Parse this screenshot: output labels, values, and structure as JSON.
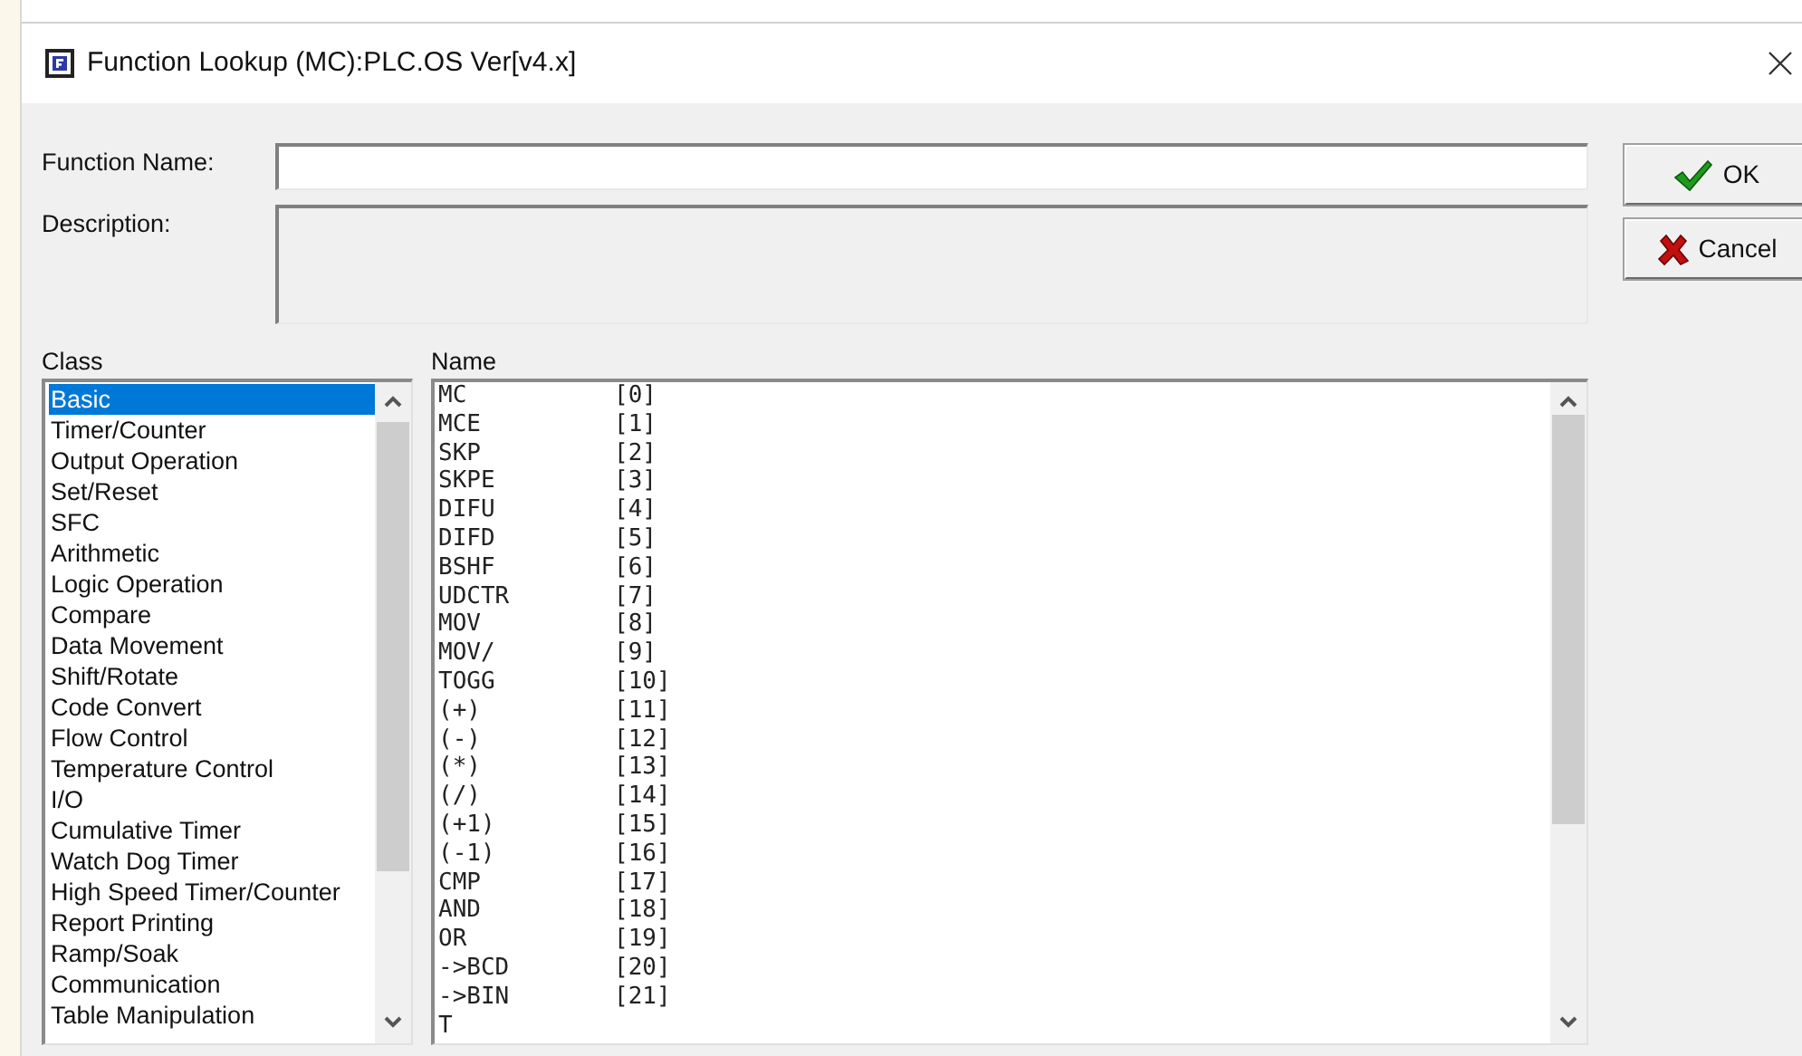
{
  "window": {
    "title": "Function Lookup (MC):PLC.OS Ver[v4.x]"
  },
  "fields": [
    {
      "label": "Function Name:"
    },
    {
      "label": "Description:"
    }
  ],
  "buttons": [
    {
      "kind": "ok",
      "label": "OK"
    },
    {
      "kind": "cancel",
      "label": "Cancel"
    }
  ],
  "class_list": {
    "heading": "Class",
    "items": [
      {
        "label": "Basic",
        "selected": true
      },
      {
        "label": "Timer/Counter",
        "selected": false
      },
      {
        "label": "Output Operation",
        "selected": false
      },
      {
        "label": "Set/Reset",
        "selected": false
      },
      {
        "label": "SFC",
        "selected": false
      },
      {
        "label": "Arithmetic",
        "selected": false
      },
      {
        "label": "Logic Operation",
        "selected": false
      },
      {
        "label": "Compare",
        "selected": false
      },
      {
        "label": "Data Movement",
        "selected": false
      },
      {
        "label": "Shift/Rotate",
        "selected": false
      },
      {
        "label": "Code Convert",
        "selected": false
      },
      {
        "label": "Flow Control",
        "selected": false
      },
      {
        "label": "Temperature Control",
        "selected": false
      },
      {
        "label": "I/O",
        "selected": false
      },
      {
        "label": "Cumulative Timer",
        "selected": false
      },
      {
        "label": "Watch Dog Timer",
        "selected": false
      },
      {
        "label": "High Speed Timer/Counter",
        "selected": false
      },
      {
        "label": "Report Printing",
        "selected": false
      },
      {
        "label": "Ramp/Soak",
        "selected": false
      },
      {
        "label": "Communication",
        "selected": false
      },
      {
        "label": "Table Manipulation",
        "selected": false
      }
    ]
  },
  "name_list": {
    "heading": "Name",
    "items": [
      {
        "name": "MC",
        "code": "[0]"
      },
      {
        "name": "MCE",
        "code": "[1]"
      },
      {
        "name": "SKP",
        "code": "[2]"
      },
      {
        "name": "SKPE",
        "code": "[3]"
      },
      {
        "name": "DIFU",
        "code": "[4]"
      },
      {
        "name": "DIFD",
        "code": "[5]"
      },
      {
        "name": "BSHF",
        "code": "[6]"
      },
      {
        "name": "UDCTR",
        "code": "[7]"
      },
      {
        "name": "MOV",
        "code": "[8]"
      },
      {
        "name": "MOV/",
        "code": "[9]"
      },
      {
        "name": "TOGG",
        "code": "[10]"
      },
      {
        "name": "(+)",
        "code": "[11]"
      },
      {
        "name": "(-)",
        "code": "[12]"
      },
      {
        "name": "(*)",
        "code": "[13]"
      },
      {
        "name": "(/)",
        "code": "[14]"
      },
      {
        "name": "(+1)",
        "code": "[15]"
      },
      {
        "name": "(-1)",
        "code": "[16]"
      },
      {
        "name": "CMP",
        "code": "[17]"
      },
      {
        "name": "AND",
        "code": "[18]"
      },
      {
        "name": "OR",
        "code": "[19]"
      },
      {
        "name": "->BCD",
        "code": "[20]"
      },
      {
        "name": "->BIN",
        "code": "[21]"
      },
      {
        "name": "T"
      }
    ]
  }
}
